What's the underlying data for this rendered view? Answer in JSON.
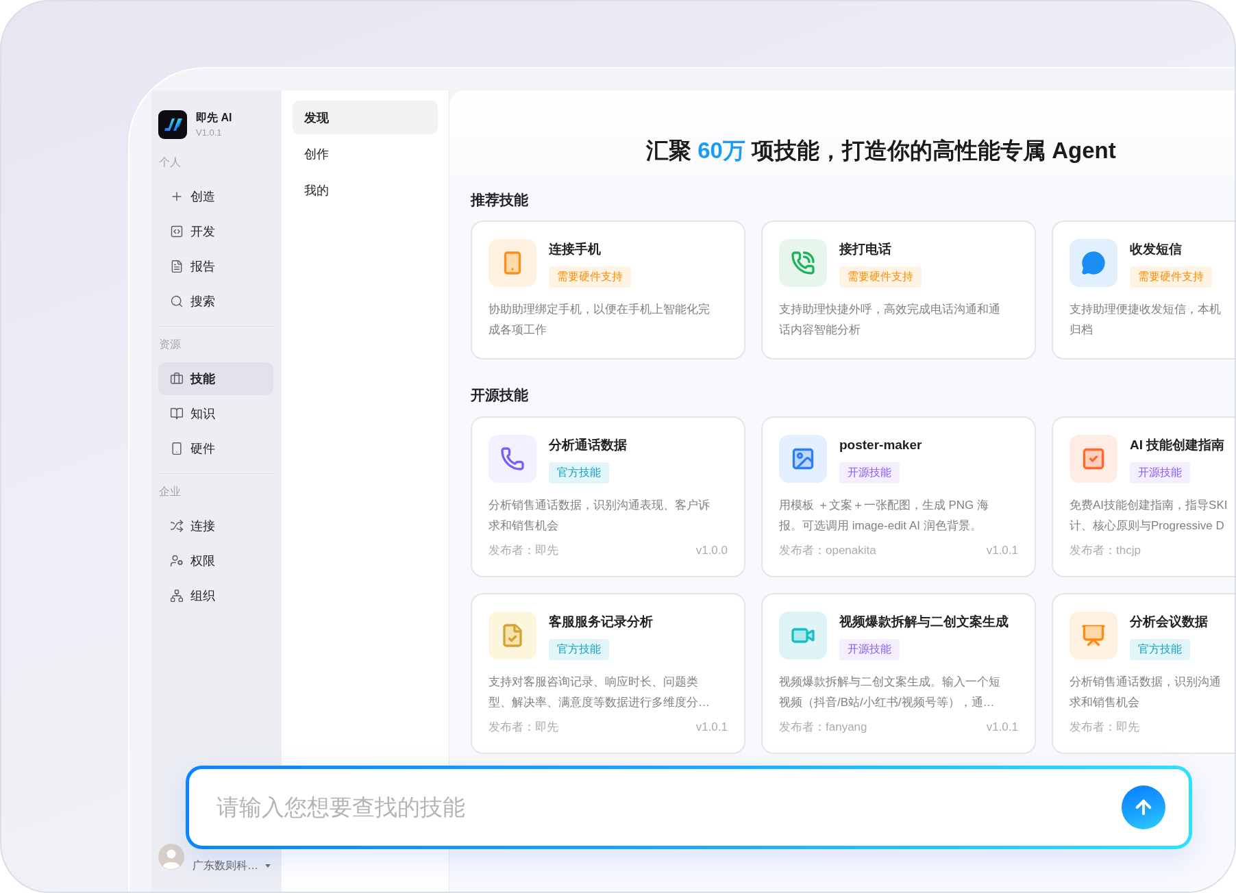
{
  "app": {
    "name": "即先 AI",
    "version": "V1.0.1"
  },
  "sidebar": {
    "sections": [
      {
        "title": "个人",
        "items": [
          {
            "label": "创造",
            "selected": false
          },
          {
            "label": "开发",
            "selected": false
          },
          {
            "label": "报告",
            "selected": false
          },
          {
            "label": "搜索",
            "selected": false
          }
        ]
      },
      {
        "title": "资源",
        "items": [
          {
            "label": "技能",
            "selected": true
          },
          {
            "label": "知识",
            "selected": false
          },
          {
            "label": "硬件",
            "selected": false
          }
        ]
      },
      {
        "title": "企业",
        "items": [
          {
            "label": "连接",
            "selected": false
          },
          {
            "label": "权限",
            "selected": false
          },
          {
            "label": "组织",
            "selected": false
          }
        ]
      }
    ]
  },
  "user": {
    "company": "广东数则科…"
  },
  "subnav": [
    {
      "label": "发现",
      "selected": true
    },
    {
      "label": "创作",
      "selected": false
    },
    {
      "label": "我的",
      "selected": false
    }
  ],
  "headline": {
    "before": "汇聚 ",
    "highlight": "60万",
    "after": " 项技能，打造你的高性能专属 Agent"
  },
  "sections": [
    {
      "title": "推荐技能",
      "cards": [
        {
          "title": "连接手机",
          "badge": {
            "text": "需要硬件支持",
            "kind": "hardware"
          },
          "description_lines": [
            "协助助理绑定手机，以便在手机上智能化完",
            "成各项工作"
          ]
        },
        {
          "title": "接打电话",
          "badge": {
            "text": "需要硬件支持",
            "kind": "hardware"
          },
          "description_lines": [
            "支持助理快捷外呼，高效完成电话沟通和通",
            "话内容智能分析"
          ]
        },
        {
          "title": "收发短信",
          "badge": {
            "text": "需要硬件支持",
            "kind": "hardware"
          },
          "description_lines": [
            "支持助理便捷收发短信，本机",
            "归档"
          ]
        }
      ]
    },
    {
      "title": "开源技能",
      "cards": [
        {
          "title": "分析通话数据",
          "badge": {
            "text": "官方技能",
            "kind": "official"
          },
          "description_lines": [
            "分析销售通话数据，识别沟通表现、客户诉",
            "求和销售机会"
          ],
          "publisher": "发布者：即先",
          "version": "v1.0.0"
        },
        {
          "title": "poster-maker",
          "badge": {
            "text": "开源技能",
            "kind": "open-source"
          },
          "description_lines": [
            "用模板 ＋文案＋一张配图，生成 PNG 海",
            "报。可选调用 image-edit AI 润色背景。"
          ],
          "publisher": "发布者：openakita",
          "version": "v1.0.1"
        },
        {
          "title": "AI 技能创建指南",
          "badge": {
            "text": "开源技能",
            "kind": "open-source"
          },
          "description_lines": [
            "免费AI技能创建指南，指导SKI",
            "计、核心原则与Progressive D"
          ],
          "publisher": "发布者：thcjp"
        },
        {
          "title": "客服服务记录分析",
          "badge": {
            "text": "官方技能",
            "kind": "official"
          },
          "description_lines": [
            "支持对客服咨询记录、响应时长、问题类",
            "型、解决率、满意度等数据进行多维度分…"
          ],
          "publisher": "发布者：即先",
          "version": "v1.0.1"
        },
        {
          "title": "视频爆款拆解与二创文案生成",
          "badge": {
            "text": "开源技能",
            "kind": "open-source"
          },
          "description_lines": [
            "视频爆款拆解与二创文案生成。输入一个短",
            "视频（抖音/B站/小红书/视频号等），通…"
          ],
          "publisher": "发布者：fanyang",
          "version": "v1.0.1"
        },
        {
          "title": "分析会议数据",
          "badge": {
            "text": "官方技能",
            "kind": "official"
          },
          "description_lines": [
            "分析销售通话数据，识别沟通",
            "求和销售机会"
          ],
          "publisher": "发布者：即先"
        }
      ]
    }
  ],
  "search": {
    "placeholder": "请输入您想要查找的技能"
  }
}
